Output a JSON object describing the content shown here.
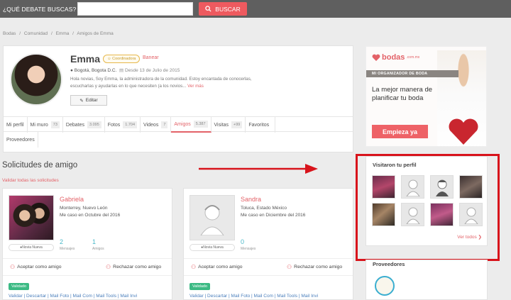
{
  "search": {
    "question": "¿QUÉ DEBATE BUSCAS?",
    "input_value": "",
    "button": "BUSCAR"
  },
  "breadcrumb": [
    "Bodas",
    "/",
    "Comunidad",
    "/",
    "Emma",
    "/",
    "Amigos de Emma"
  ],
  "profile": {
    "name": "Emma",
    "badge": "Coordinadora",
    "ban": "Banear",
    "location": "Bogotá, Bogota D.C.",
    "since": "Desde 13 de Julio de 2015",
    "bio": "Hola novias, Soy Emma, la administradora de la comunidad. Estoy encantada de conocerlas, escucharlas y ayudarlas en lo que necesiten (a los novios...",
    "bio_more": "Ver más",
    "edit": "Editar"
  },
  "tabs": [
    {
      "label": "Mi perfil",
      "count": ""
    },
    {
      "label": "Mi muro",
      "count": "73"
    },
    {
      "label": "Debates",
      "count": "3.095"
    },
    {
      "label": "Fotos",
      "count": "1.704"
    },
    {
      "label": "Videos",
      "count": "7"
    },
    {
      "label": "Amigos",
      "count": "5.387",
      "active": true
    },
    {
      "label": "Visitas",
      "count": "+99"
    },
    {
      "label": "Favoritos",
      "count": ""
    }
  ],
  "tab_second_row": "Proveedores",
  "requests": {
    "title": "Solicitudes de amigo",
    "validate_all": "Validar todas las solicitudes",
    "cards": [
      {
        "name": "Gabriela",
        "location": "Monterrey, Nuevo León",
        "wedding": "Me caso en Octubre del 2016",
        "role": "Novia Nueva",
        "messages": "2",
        "messages_label": "Mensajes",
        "friends": "1",
        "friends_label": "Amigos",
        "accept": "Aceptar como amigo",
        "reject": "Rechazar como amigo",
        "status": "Validado",
        "links": "Validar | Descartar | Mail Foto | Mail Com | Mail Tools | Mail Invi"
      },
      {
        "name": "Sandra",
        "location": "Toluca, Estado México",
        "wedding": "Me caso en Diciembre del 2016",
        "role": "Novia Nueva",
        "messages": "0",
        "messages_label": "Mensajes",
        "accept": "Aceptar como amigo",
        "reject": "Rechazar como amigo",
        "status": "Validado",
        "links": "Validar | Descartar | Mail Foto | Mail Com | Mail Tools | Mail Invi"
      }
    ]
  },
  "ad": {
    "brand": "bodas",
    "brand_suffix": ".com.mx",
    "strip": "MI ORGANIZADOR DE BODA",
    "slogan": "La mejor manera de planificar tu boda",
    "cta": "Empieza ya"
  },
  "visitors": {
    "title": "Visitaron tu perfil",
    "see_all": "Ver todos",
    "thumbs": [
      "photo",
      "placeholder",
      "placeholder-male",
      "photo",
      "photo",
      "placeholder",
      "photo",
      "placeholder"
    ]
  },
  "next_widget": {
    "title": "Proveedores"
  },
  "colors": {
    "accent": "#e36268",
    "topbar": "#5f5f5f",
    "highlight": "#d8131b",
    "link": "#4b7fbc",
    "validated": "#3cba84"
  }
}
